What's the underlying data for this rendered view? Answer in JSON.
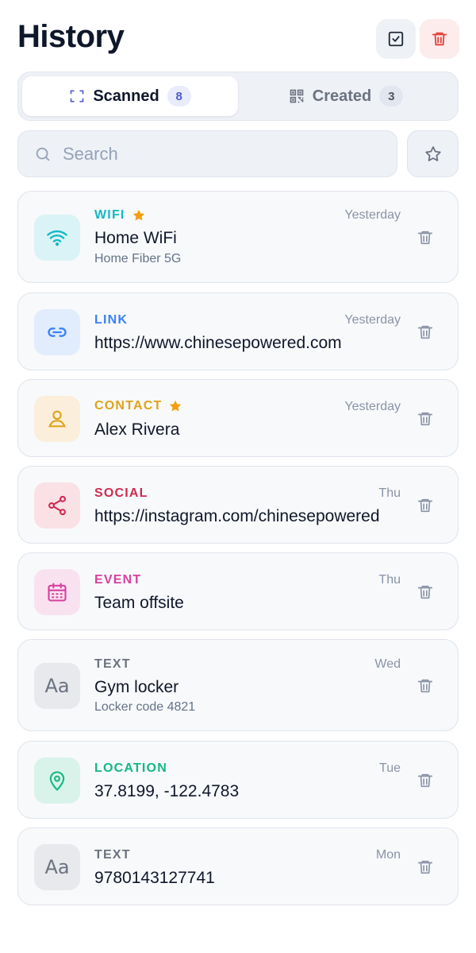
{
  "header": {
    "title": "History"
  },
  "tabs": [
    {
      "label": "Scanned",
      "count": "8",
      "active": true
    },
    {
      "label": "Created",
      "count": "3",
      "active": false
    }
  ],
  "search": {
    "placeholder": "Search",
    "value": ""
  },
  "items": [
    {
      "type": "WIFI",
      "starred": true,
      "title": "Home WiFi",
      "subtitle": "Home Fiber 5G",
      "time": "Yesterday",
      "icon": "wifi-icon",
      "color": "#14b8c4",
      "tile_bg": "#daf3f6"
    },
    {
      "type": "LINK",
      "starred": false,
      "title": "https://www.chinesepowered.com",
      "subtitle": "",
      "time": "Yesterday",
      "icon": "link-icon",
      "color": "#3b82f6",
      "tile_bg": "#e1ecfd"
    },
    {
      "type": "CONTACT",
      "starred": true,
      "title": "Alex Rivera",
      "subtitle": "",
      "time": "Yesterday",
      "icon": "person-icon",
      "color": "#e0a21a",
      "tile_bg": "#fbeeda"
    },
    {
      "type": "SOCIAL",
      "starred": false,
      "title": "https://instagram.com/chinesepowered",
      "subtitle": "",
      "time": "Thu",
      "icon": "share-icon",
      "color": "#d02a4e",
      "tile_bg": "#f9e1e6"
    },
    {
      "type": "EVENT",
      "starred": false,
      "title": "Team offsite",
      "subtitle": "",
      "time": "Thu",
      "icon": "calendar-icon",
      "color": "#d6409f",
      "tile_bg": "#f9e2f0"
    },
    {
      "type": "TEXT",
      "starred": false,
      "title": "Gym locker",
      "subtitle": "Locker code 4821",
      "time": "Wed",
      "icon": "text-icon",
      "icon_text": "Aa",
      "color": "#6b7280",
      "tile_bg": "#e7e9ed"
    },
    {
      "type": "LOCATION",
      "starred": false,
      "title": "37.8199, -122.4783",
      "subtitle": "",
      "time": "Tue",
      "icon": "location-pin-icon",
      "color": "#10b981",
      "tile_bg": "#d9f3ea"
    },
    {
      "type": "TEXT",
      "starred": false,
      "title": "9780143127741",
      "subtitle": "",
      "time": "Mon",
      "icon": "text-icon",
      "icon_text": "Aa",
      "color": "#6b7280",
      "tile_bg": "#e7e9ed"
    }
  ],
  "colors": {
    "star": "#f59e0b",
    "delete_accent": "#e0443c",
    "tab_badge_active": "#4f5bd5"
  }
}
